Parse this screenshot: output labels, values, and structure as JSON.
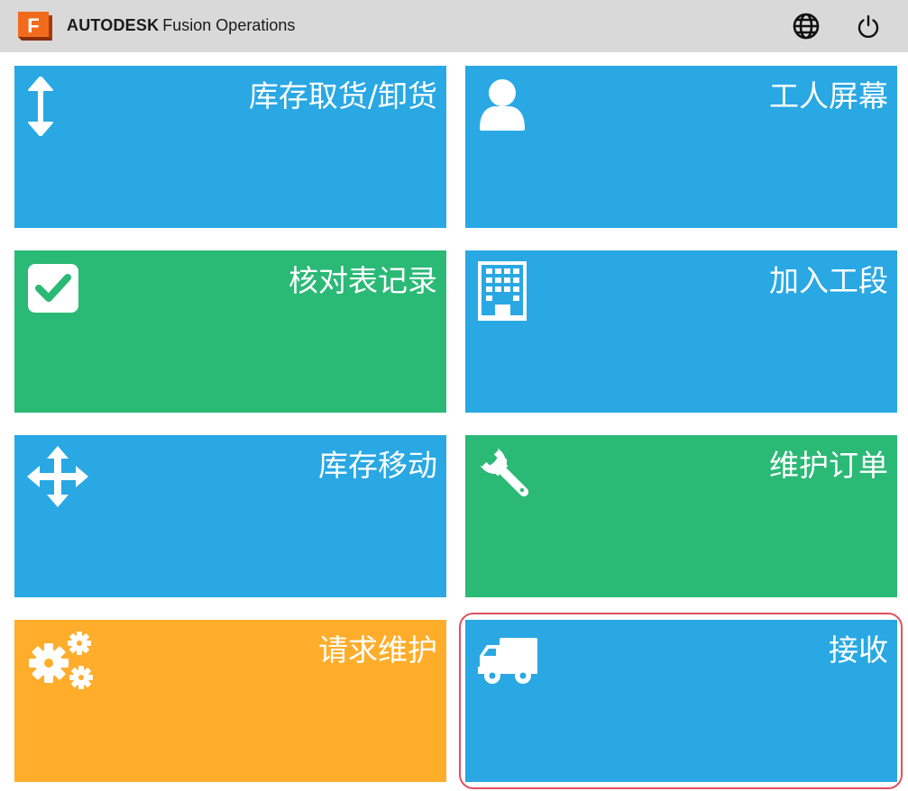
{
  "header": {
    "brand_bold": "AUTODESK",
    "brand_rest": "Fusion Operations",
    "logo_letter": "F",
    "logo_color": "#f26b1d",
    "language_icon": "globe-icon",
    "power_icon": "power-icon"
  },
  "tiles": [
    {
      "label": "库存取货/卸货",
      "icon": "vertical-arrows-icon",
      "color": "#29a8e4"
    },
    {
      "label": "工人屏幕",
      "icon": "user-icon",
      "color": "#29a8e4"
    },
    {
      "label": "核对表记录",
      "icon": "checkbox-icon",
      "color": "#2bb976"
    },
    {
      "label": "加入工段",
      "icon": "building-icon",
      "color": "#29a8e4"
    },
    {
      "label": "库存移动",
      "icon": "move-arrows-icon",
      "color": "#29a8e4"
    },
    {
      "label": "维护订单",
      "icon": "wrench-icon",
      "color": "#2bb976"
    },
    {
      "label": "请求维护",
      "icon": "gears-icon",
      "color": "#ffad2b"
    },
    {
      "label": "接收",
      "icon": "truck-icon",
      "color": "#29a8e4",
      "highlighted": true
    }
  ],
  "highlight_color": "#e05060"
}
